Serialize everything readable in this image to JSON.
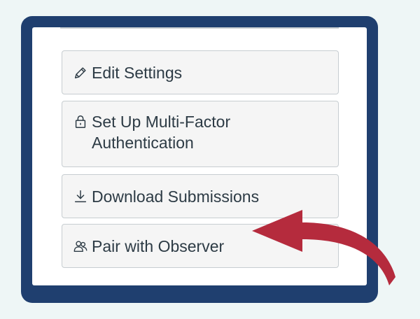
{
  "colors": {
    "background": "#eef6f6",
    "frame": "#1f3f6f",
    "panel": "#ffffff",
    "button_bg": "#f5f5f5",
    "button_border": "#c7cdd1",
    "text": "#2d3b45",
    "arrow": "#b52b3d"
  },
  "actions": {
    "edit_settings": {
      "label": "Edit Settings",
      "icon": "pencil-icon"
    },
    "mfa": {
      "label": "Set Up Multi-Factor Authentication",
      "icon": "lock-icon"
    },
    "download_submissions": {
      "label": "Download Submissions",
      "icon": "download-icon"
    },
    "pair_with_observer": {
      "label": "Pair with Observer",
      "icon": "observer-icon"
    }
  },
  "annotation": {
    "icon": "curved-arrow-icon",
    "color": "#b52b3d"
  }
}
